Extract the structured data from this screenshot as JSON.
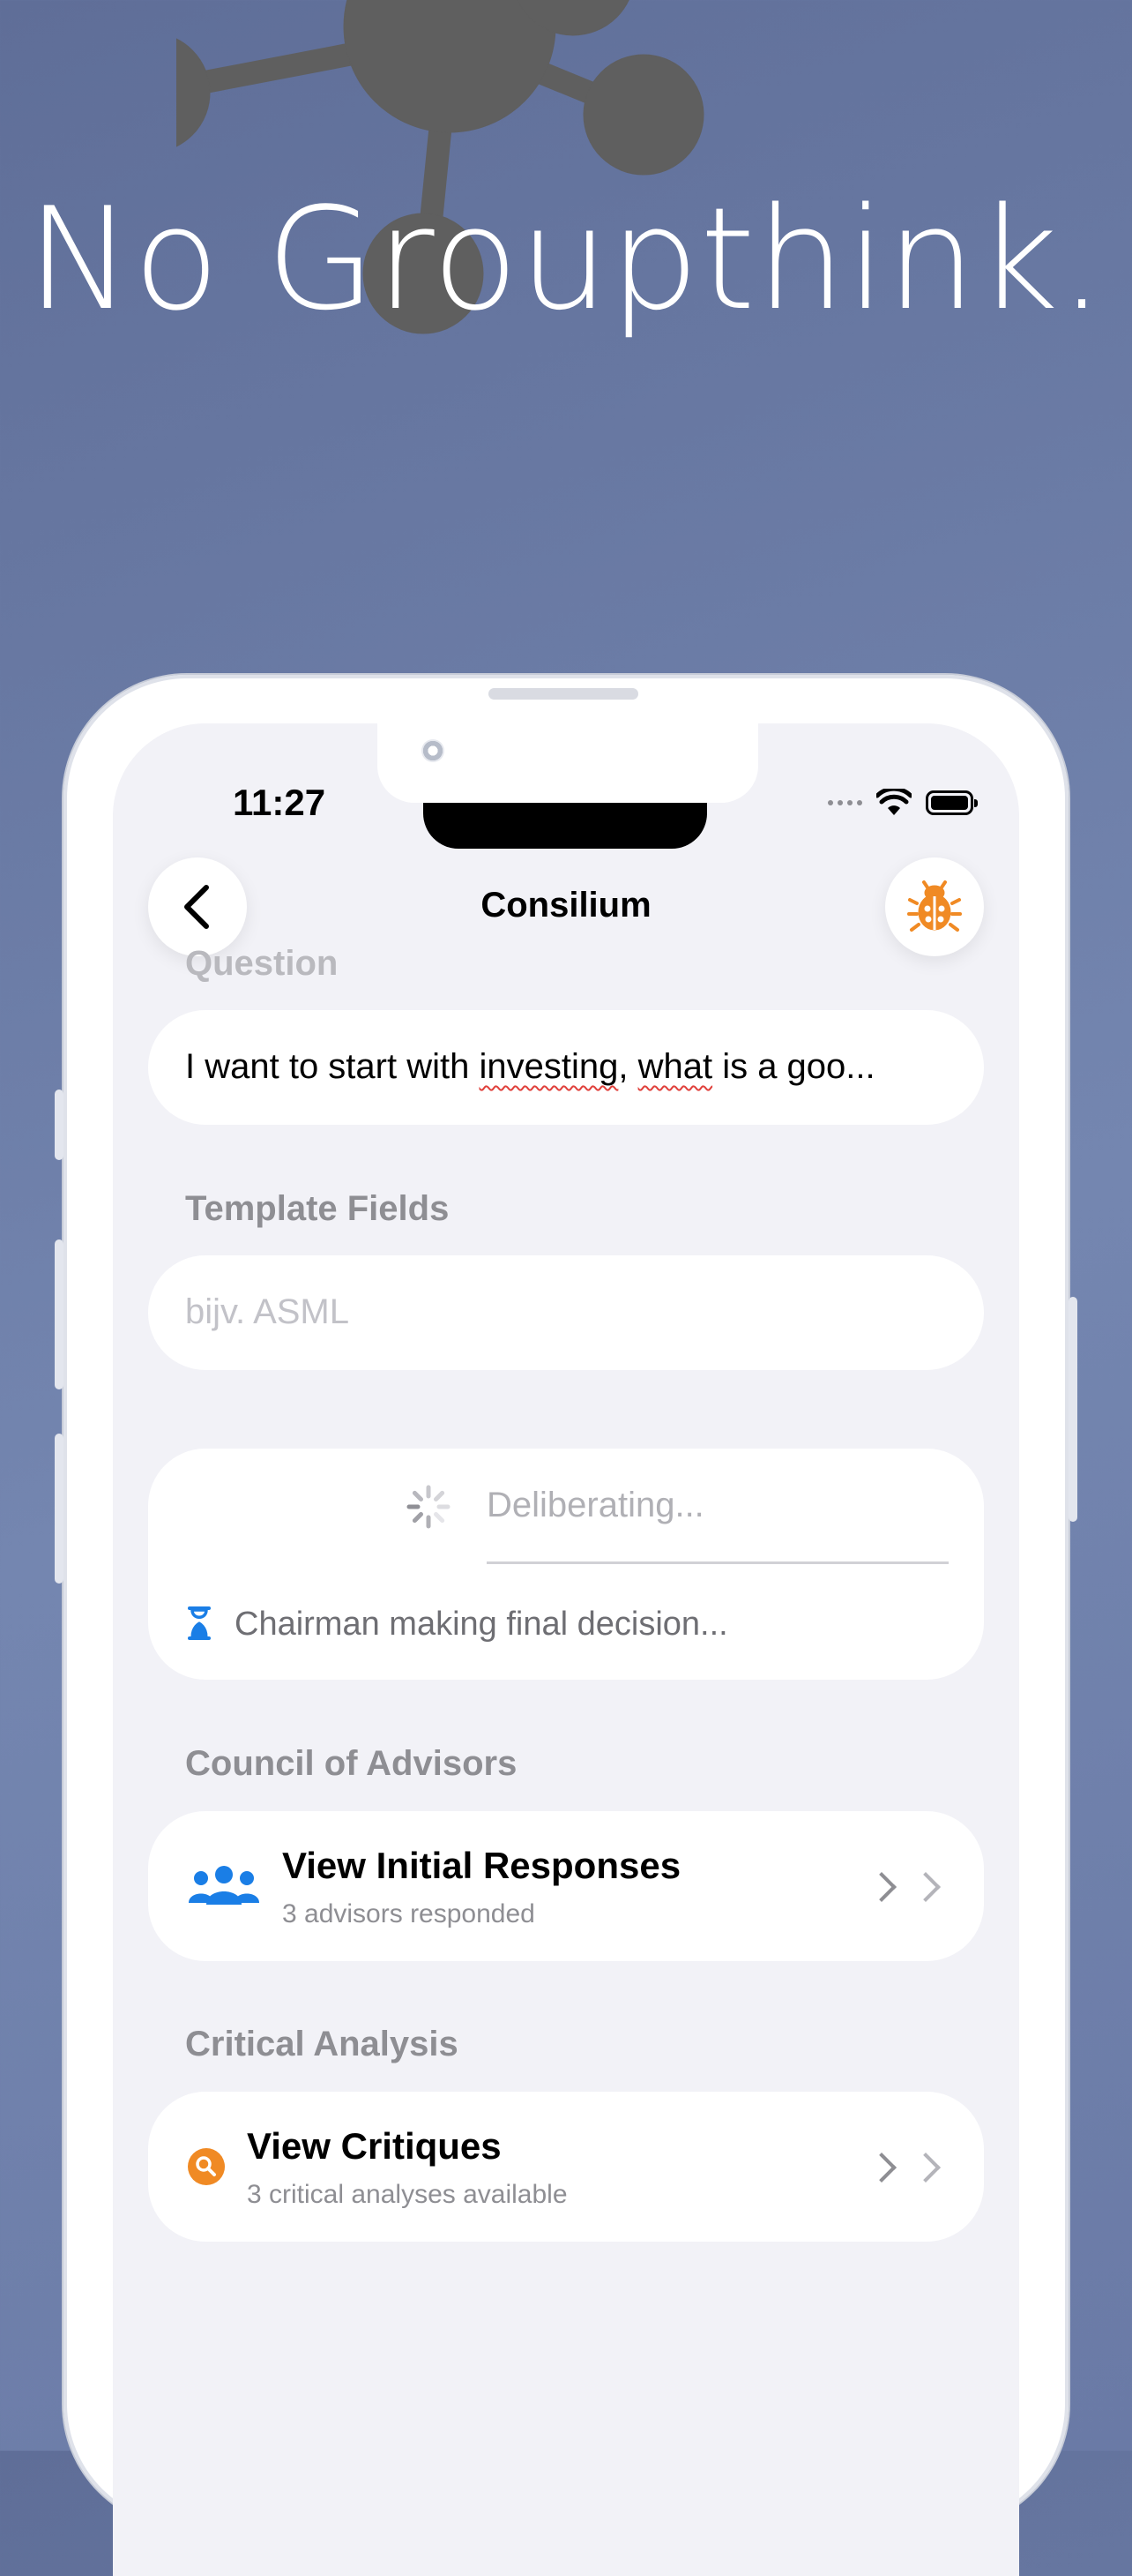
{
  "hero": {
    "headline": "No Groupthink.",
    "graphic": "network-nodes-graphic"
  },
  "status_bar": {
    "time": "11:27",
    "icons": [
      "signal-dots-icon",
      "wifi-icon",
      "battery-icon"
    ]
  },
  "nav": {
    "title": "Consilium",
    "back_icon": "chevron-left-icon",
    "debug_icon": "ladybug-icon"
  },
  "question": {
    "label": "Question",
    "value_parts": [
      "I want to start with ",
      "investing",
      ", ",
      "what",
      " is a goo..."
    ]
  },
  "template_fields": {
    "label": "Template Fields",
    "placeholder": "bijv. ASML"
  },
  "deliberation": {
    "status": "Deliberating...",
    "step": "Chairman making final decision..."
  },
  "council": {
    "label": "Council of Advisors",
    "title": "View Initial Responses",
    "subtitle": "3 advisors responded",
    "icon": "people-group-icon"
  },
  "critical": {
    "label": "Critical Analysis",
    "title": "View Critiques",
    "subtitle": "3 critical analyses available",
    "icon": "magnifier-icon"
  },
  "colors": {
    "background": "#6a7aa6",
    "accent_blue": "#1a7ee6",
    "accent_orange": "#f08a24",
    "secondary_text": "#8e8e93"
  }
}
